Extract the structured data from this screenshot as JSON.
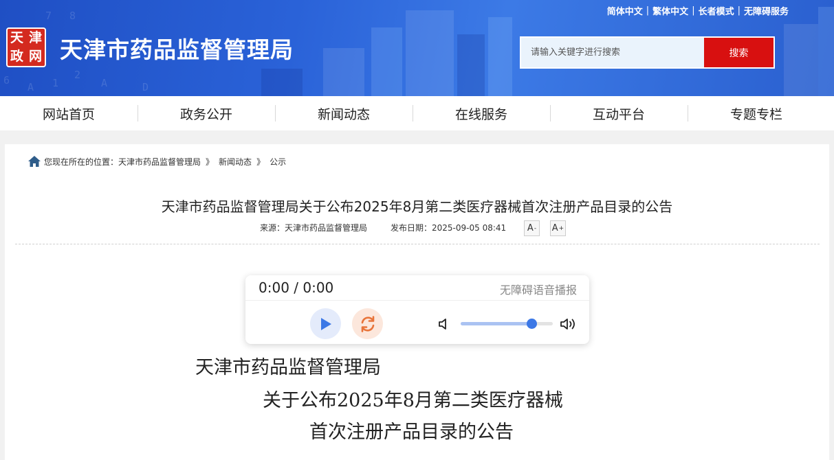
{
  "header": {
    "logo_chars": [
      "天",
      "津",
      "政",
      "网"
    ],
    "site_title": "天津市药品监督管理局",
    "top_links": [
      "简体中文",
      "繁体中文",
      "长者模式",
      "无障碍服务"
    ],
    "search": {
      "placeholder": "请输入关键字进行搜索",
      "button_label": "搜索"
    },
    "banner_digits": [
      "7",
      "8",
      "6",
      "A",
      "1",
      "2",
      "A",
      "D"
    ]
  },
  "nav": {
    "items": [
      "网站首页",
      "政务公开",
      "新闻动态",
      "在线服务",
      "互动平台",
      "专题专栏"
    ]
  },
  "breadcrumb": {
    "prefix": "您现在所在的位置：",
    "items": [
      "天津市药品监督管理局",
      "新闻动态",
      "公示"
    ],
    "separator": "》"
  },
  "article": {
    "title": "天津市药品监督管理局关于公布2025年8月第二类医疗器械首次注册产品目录的公告",
    "source": "来源：天津市药品监督管理局",
    "date": "发布日期：2025-09-05 08:41",
    "font_decrease": "A",
    "font_increase": "A",
    "font_decrease_sign": "-",
    "font_increase_sign": "+"
  },
  "player": {
    "time": "0:00 / 0:00",
    "title": "无障碍语音播报",
    "volume_fraction": 0.77
  },
  "doc_heading": [
    "天津市药品监督管理局",
    "关于公布2025年8月第二类医疗器械",
    "首次注册产品目录的公告"
  ],
  "colors": {
    "banner": "#2a62d8",
    "search_button": "#d81010",
    "logo": "#d42a1f",
    "play": "#3c78e6",
    "loop": "#e8743a"
  }
}
